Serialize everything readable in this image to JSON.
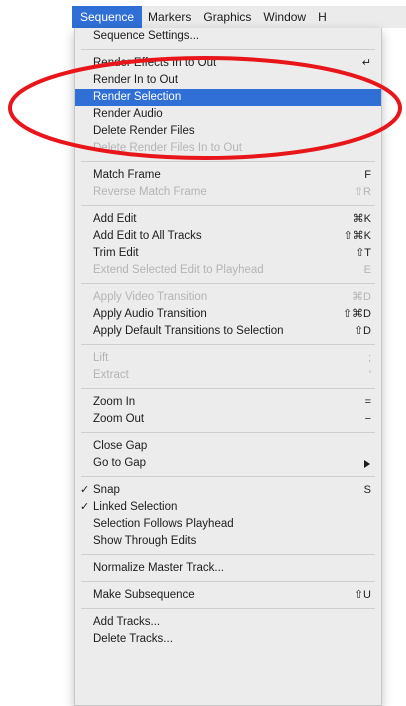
{
  "menubar": {
    "items": [
      {
        "label": "Sequence",
        "active": true
      },
      {
        "label": "Markers"
      },
      {
        "label": "Graphics"
      },
      {
        "label": "Window"
      },
      {
        "label": "H"
      }
    ]
  },
  "menu": {
    "g1": {
      "sequence_settings": "Sequence Settings..."
    },
    "g2": {
      "render_effects": "Render Effects In to Out",
      "render_effects_shortcut": "↵",
      "render_in_out": "Render In to Out",
      "render_selection": "Render Selection",
      "render_audio": "Render Audio",
      "delete_render_files": "Delete Render Files",
      "delete_render_in_out": "Delete Render Files In to Out"
    },
    "g3": {
      "match_frame": "Match Frame",
      "match_frame_shortcut": "F",
      "reverse_match_frame": "Reverse Match Frame",
      "reverse_match_frame_shortcut": "⇧R"
    },
    "g4": {
      "add_edit": "Add Edit",
      "add_edit_shortcut": "⌘K",
      "add_edit_all": "Add Edit to All Tracks",
      "add_edit_all_shortcut": "⇧⌘K",
      "trim_edit": "Trim Edit",
      "trim_edit_shortcut": "⇧T",
      "extend_edit": "Extend Selected Edit to Playhead",
      "extend_edit_shortcut": "E"
    },
    "g5": {
      "apply_video_transition": "Apply Video Transition",
      "apply_video_transition_shortcut": "⌘D",
      "apply_audio_transition": "Apply Audio Transition",
      "apply_audio_transition_shortcut": "⇧⌘D",
      "apply_default_transitions": "Apply Default Transitions to Selection",
      "apply_default_transitions_shortcut": "⇧D"
    },
    "g6": {
      "lift": "Lift",
      "lift_shortcut": ";",
      "extract": "Extract",
      "extract_shortcut": "'"
    },
    "g7": {
      "zoom_in": "Zoom In",
      "zoom_in_shortcut": "=",
      "zoom_out": "Zoom Out",
      "zoom_out_shortcut": "−"
    },
    "g8": {
      "close_gap": "Close Gap",
      "go_to_gap": "Go to Gap"
    },
    "g9": {
      "snap": "Snap",
      "snap_shortcut": "S",
      "linked_selection": "Linked Selection",
      "selection_follows_playhead": "Selection Follows Playhead",
      "show_through_edits": "Show Through Edits",
      "check_glyph": "✓"
    },
    "g10": {
      "normalize_master_track": "Normalize Master Track..."
    },
    "g11": {
      "make_subsequence": "Make Subsequence",
      "make_subsequence_shortcut": "⇧U"
    },
    "g12": {
      "add_tracks": "Add Tracks...",
      "delete_tracks": "Delete Tracks..."
    }
  },
  "colors": {
    "highlight": "#2f6fd6",
    "menu_bg": "#ececec",
    "annotation": "#e8161b"
  }
}
